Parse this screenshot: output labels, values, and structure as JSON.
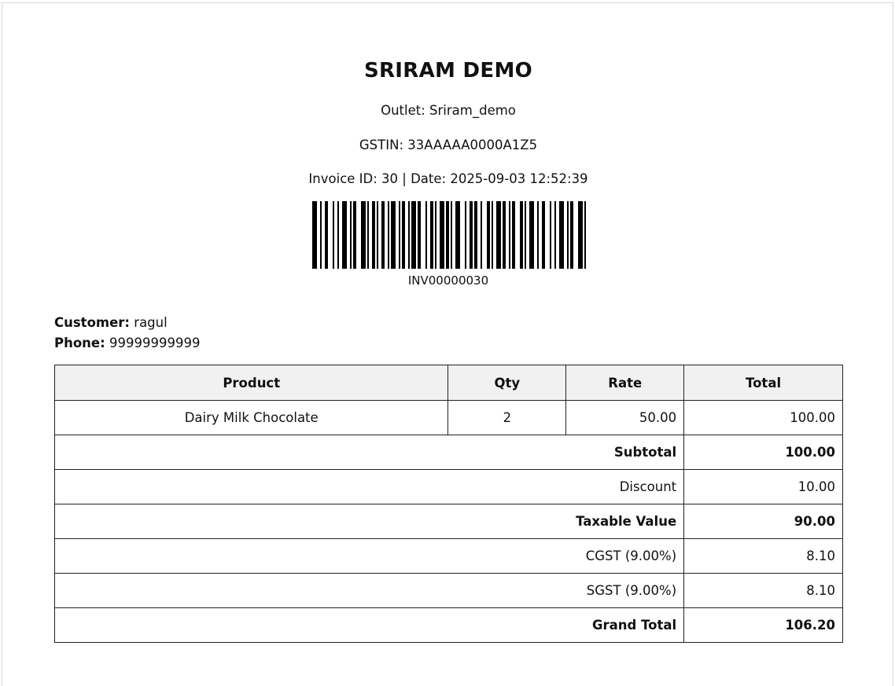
{
  "store": {
    "name": "SRIRAM DEMO",
    "outlet": "Outlet: Sriram_demo",
    "gstin": "GSTIN: 33AAAAA0000A1Z5",
    "invoice_line": "Invoice ID: 30 | Date: 2025-09-03 12:52:39"
  },
  "barcode": {
    "text": "INV00000030",
    "icon": "barcode-icon"
  },
  "customer": {
    "customer_label": "Customer:",
    "customer_value": "ragul",
    "phone_label": "Phone:",
    "phone_value": "99999999999"
  },
  "table": {
    "headers": [
      "Product",
      "Qty",
      "Rate",
      "Total"
    ],
    "items": [
      {
        "product": "Dairy Milk Chocolate",
        "qty": "2",
        "rate": "50.00",
        "total": "100.00"
      }
    ],
    "summary": [
      {
        "label": "Subtotal",
        "value": "100.00",
        "bold": true
      },
      {
        "label": "Discount",
        "value": "10.00",
        "bold": false
      },
      {
        "label": "Taxable Value",
        "value": "90.00",
        "bold": true
      },
      {
        "label": "CGST (9.00%)",
        "value": "8.10",
        "bold": false
      },
      {
        "label": "SGST (9.00%)",
        "value": "8.10",
        "bold": false
      },
      {
        "label": "Grand Total",
        "value": "106.20",
        "bold": true
      }
    ]
  }
}
